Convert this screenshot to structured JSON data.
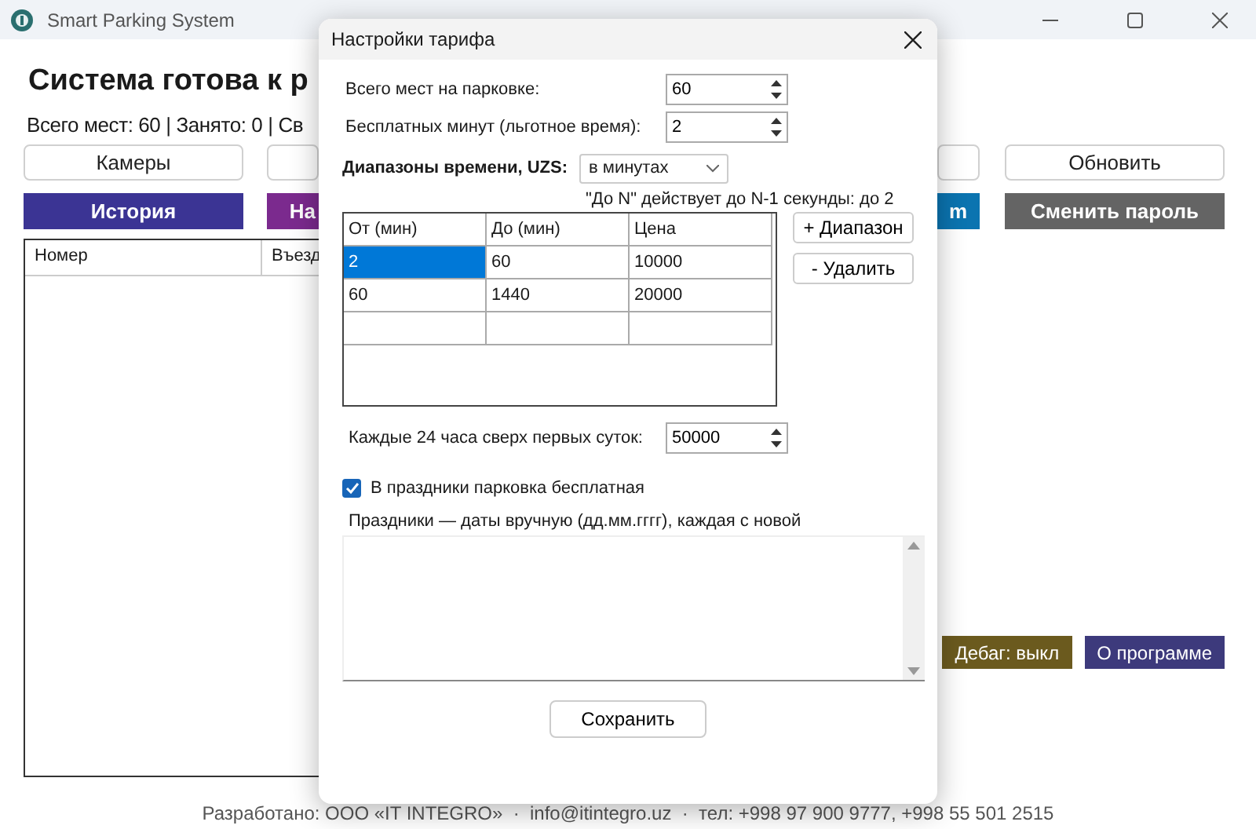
{
  "window": {
    "title": "Smart Parking System"
  },
  "main": {
    "heading": "Система готова к р",
    "stats": "Всего мест: 60 | Занято: 0 | Св",
    "buttons_row1": [
      {
        "kind": "button",
        "label": "Камеры"
      },
      {
        "kind": "stub"
      },
      {
        "kind": "stub"
      },
      {
        "kind": "button",
        "label": "Обновить"
      }
    ],
    "buttons_row2": [
      {
        "label": "История",
        "color": "#3b3494"
      },
      {
        "label": "На",
        "color": "#7b2a8e"
      },
      {
        "label": "m",
        "color": "#0b74b0"
      },
      {
        "label": "Сменить пароль",
        "color": "#646464"
      }
    ],
    "table": {
      "columns": [
        "Номер",
        "Въезд"
      ]
    },
    "bottom_buttons": [
      {
        "label": "Дебаг: выкл",
        "color": "#6b5a1e"
      },
      {
        "label": "О программе",
        "color": "#3d3a7c"
      }
    ],
    "footer": "Разработано: ООО «IT INTEGRO»  ·  info@itintegro.uz  ·  тел: +998 97 900 9777, +998 55 501 2515"
  },
  "dialog": {
    "title": "Настройки тарифа",
    "fields": [
      {
        "label": "Всего мест на парковке:",
        "value": "60"
      },
      {
        "label": "Бесплатных минут (льготное время):",
        "value": "2"
      }
    ],
    "ranges": {
      "label": "Диапазоны времени, UZS:",
      "unit": "в минутах",
      "note": "\"До N\" действует до N-1 секунды: до 2",
      "columns": [
        "От (мин)",
        "До (мин)",
        "Цена"
      ],
      "rows": [
        {
          "cells": [
            {
              "text": "2",
              "selected": true
            },
            {
              "text": "60",
              "selected": false
            },
            {
              "text": "10000",
              "selected": false
            }
          ]
        },
        {
          "cells": [
            {
              "text": "60",
              "selected": false
            },
            {
              "text": "1440",
              "selected": false
            },
            {
              "text": "20000",
              "selected": false
            }
          ]
        },
        {
          "cells": [
            {
              "selected": false
            },
            {
              "selected": false
            },
            {
              "selected": false
            }
          ]
        }
      ],
      "buttons": [
        "+ Диапазон",
        "- Удалить"
      ]
    },
    "daily": {
      "label": "Каждые 24 часа сверх первых суток:",
      "value": "50000"
    },
    "holidays_free": {
      "label": "В праздники парковка бесплатная",
      "checked": true
    },
    "holidays": {
      "label": "Праздники — даты вручную (дд.мм.гггг), каждая с новой"
    },
    "save": "Сохранить"
  }
}
